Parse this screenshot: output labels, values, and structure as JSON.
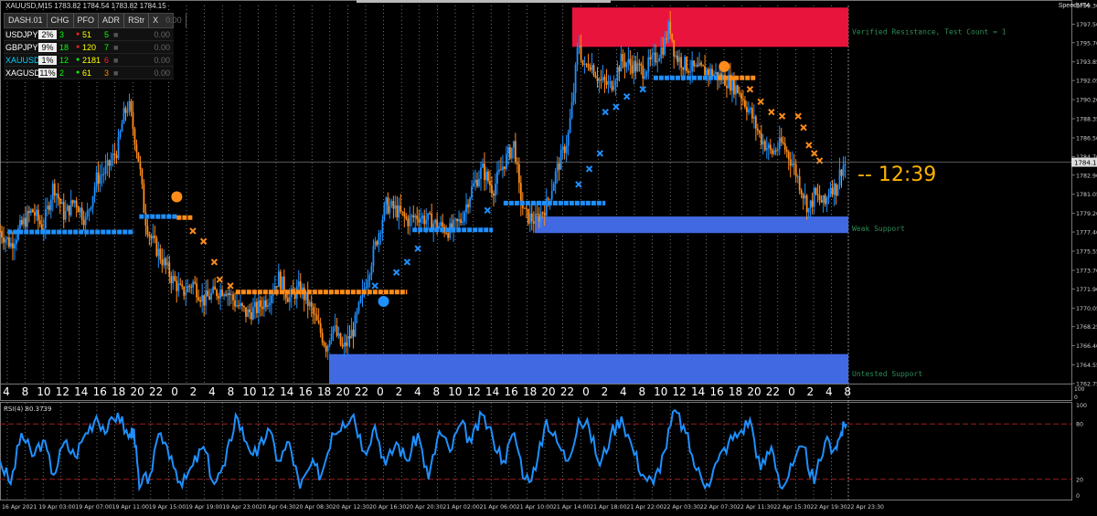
{
  "header": {
    "symbol_info": "XAUUSD,M15  1783.82 1784.54 1783.82 1784.15",
    "speed_label": "SpeedMT4"
  },
  "dashboard": {
    "title": "DASH.01",
    "columns": [
      "CHG",
      "PFO",
      "ADR",
      "RStr",
      "X"
    ],
    "rows": [
      {
        "symbol": "USDJPY",
        "chg": "2%",
        "pfo": "3",
        "adr": "51",
        "rstr": "5",
        "value": "0.00",
        "sym_color": "#ffffff",
        "pfo_color": "#00ff00",
        "dot_color": "#ff2222",
        "adr_color": "#ffff00",
        "rstr_color": "#00ff00"
      },
      {
        "symbol": "GBPJPY",
        "chg": "9%",
        "pfo": "18",
        "adr": "120",
        "rstr": "7",
        "value": "0.00",
        "sym_color": "#ffffff",
        "pfo_color": "#00ff00",
        "dot_color": "#ff2222",
        "adr_color": "#ffff00",
        "rstr_color": "#00ff00"
      },
      {
        "symbol": "XAUUSD",
        "chg": "1%",
        "pfo": "12",
        "adr": "2181",
        "rstr": "6",
        "value": "0.00",
        "sym_color": "#00d0ff",
        "pfo_color": "#00ff00",
        "dot_color": "#00ff00",
        "adr_color": "#ffff00",
        "rstr_color": "#ff2222"
      },
      {
        "symbol": "XAGUSD",
        "chg": "11%",
        "pfo": "2",
        "adr": "61",
        "rstr": "3",
        "value": "0.00",
        "sym_color": "#ffffff",
        "pfo_color": "#00ff00",
        "dot_color": "#00ff00",
        "adr_color": "#ffff00",
        "rstr_color": "#ff8800"
      }
    ]
  },
  "zones": {
    "resistance_label": "Verified Resistance, Test Count = 1",
    "weak_support_label": "Weak Support",
    "untested_support_label": "Untested Support",
    "timer": "-- 12:39",
    "resistance_color": "#e8143c",
    "support_color": "#4169e1"
  },
  "price_axis": {
    "ticks": [
      "1799.30",
      "1797.50",
      "1795.70",
      "1793.85",
      "1792.05",
      "1790.20",
      "1788.35",
      "1786.50",
      "1784.70",
      "1782.90",
      "1781.05",
      "1779.20",
      "1777.40",
      "1775.55",
      "1773.70",
      "1771.90",
      "1770.05",
      "1768.25",
      "1766.40",
      "1764.55",
      "1762.75"
    ],
    "current_price": "1784.15"
  },
  "session_axis": {
    "hour_labels": [
      "4",
      "8",
      "10",
      "12",
      "14",
      "16",
      "18",
      "20",
      "22",
      "0",
      "2",
      "4",
      "8",
      "10",
      "12",
      "14",
      "16",
      "18",
      "20",
      "22",
      "0",
      "2",
      "4",
      "8",
      "10",
      "12",
      "14",
      "16",
      "18",
      "20",
      "22",
      "0",
      "2",
      "4",
      "8",
      "10",
      "12",
      "14",
      "16",
      "18",
      "20",
      "22",
      "0",
      "2",
      "4",
      "8"
    ],
    "side_ticks": [
      "100",
      "0"
    ]
  },
  "rsi": {
    "label": "RSI(4) 80.3739",
    "levels": [
      "80",
      "20"
    ],
    "axis_ticks": [
      "100",
      "0"
    ],
    "line_color": "#1e90ff"
  },
  "time_axis": {
    "labels": [
      "16 Apr 2021",
      "19 Apr 03:00",
      "19 Apr 07:00",
      "19 Apr 11:00",
      "19 Apr 15:00",
      "19 Apr 19:00",
      "19 Apr 23:00",
      "20 Apr 04:30",
      "20 Apr 08:30",
      "20 Apr 12:30",
      "20 Apr 16:30",
      "20 Apr 20:30",
      "21 Apr 02:00",
      "21 Apr 06:00",
      "21 Apr 10:00",
      "21 Apr 14:00",
      "21 Apr 18:00",
      "21 Apr 22:00",
      "22 Apr 03:30",
      "22 Apr 07:30",
      "22 Apr 11:30",
      "22 Apr 15:30",
      "22 Apr 19:30",
      "22 Apr 23:30"
    ]
  },
  "chart_data": {
    "type": "candlestick",
    "symbol": "XAUUSD",
    "timeframe": "M15",
    "ylim": [
      1762.75,
      1799.3
    ],
    "rsi_ylim": [
      0,
      100
    ],
    "current_price": 1784.15,
    "zones": [
      {
        "name": "Verified Resistance, Test Count = 1",
        "y_low": 1795.3,
        "y_high": 1799.1,
        "x_start": 0.52
      },
      {
        "name": "Weak Support",
        "y_low": 1777.3,
        "y_high": 1778.9,
        "x_start": 0.485
      },
      {
        "name": "Untested Support",
        "y_low": 1762.75,
        "y_high": 1765.6,
        "x_start": 0.3
      }
    ],
    "close_path": [
      [
        0.0,
        1777.5
      ],
      [
        0.01,
        1776.2
      ],
      [
        0.02,
        1778.0
      ],
      [
        0.03,
        1779.5
      ],
      [
        0.04,
        1777.8
      ],
      [
        0.05,
        1782.0
      ],
      [
        0.06,
        1779.0
      ],
      [
        0.07,
        1780.5
      ],
      [
        0.08,
        1778.5
      ],
      [
        0.09,
        1782.5
      ],
      [
        0.1,
        1783.5
      ],
      [
        0.11,
        1785.5
      ],
      [
        0.115,
        1788.5
      ],
      [
        0.12,
        1789.8
      ],
      [
        0.125,
        1787.0
      ],
      [
        0.13,
        1784.0
      ],
      [
        0.135,
        1779.0
      ],
      [
        0.14,
        1777.0
      ],
      [
        0.15,
        1775.0
      ],
      [
        0.16,
        1773.0
      ],
      [
        0.17,
        1771.5
      ],
      [
        0.18,
        1772.5
      ],
      [
        0.19,
        1770.8
      ],
      [
        0.2,
        1771.5
      ],
      [
        0.21,
        1772.0
      ],
      [
        0.22,
        1770.5
      ],
      [
        0.23,
        1769.5
      ],
      [
        0.24,
        1770.0
      ],
      [
        0.25,
        1771.0
      ],
      [
        0.26,
        1773.0
      ],
      [
        0.27,
        1771.0
      ],
      [
        0.28,
        1772.0
      ],
      [
        0.29,
        1770.0
      ],
      [
        0.3,
        1767.5
      ],
      [
        0.305,
        1766.2
      ],
      [
        0.31,
        1768.5
      ],
      [
        0.32,
        1766.0
      ],
      [
        0.33,
        1768.0
      ],
      [
        0.34,
        1772.0
      ],
      [
        0.35,
        1776.0
      ],
      [
        0.36,
        1780.0
      ],
      [
        0.37,
        1779.5
      ],
      [
        0.38,
        1778.5
      ],
      [
        0.39,
        1779.0
      ],
      [
        0.4,
        1778.5
      ],
      [
        0.41,
        1778.0
      ],
      [
        0.42,
        1777.5
      ],
      [
        0.43,
        1778.5
      ],
      [
        0.44,
        1781.5
      ],
      [
        0.45,
        1783.5
      ],
      [
        0.46,
        1781.5
      ],
      [
        0.47,
        1784.0
      ],
      [
        0.48,
        1786.0
      ],
      [
        0.485,
        1781.0
      ],
      [
        0.49,
        1779.0
      ],
      [
        0.5,
        1778.5
      ],
      [
        0.51,
        1780.0
      ],
      [
        0.52,
        1783.5
      ],
      [
        0.53,
        1786.5
      ],
      [
        0.535,
        1790.5
      ],
      [
        0.54,
        1796.0
      ],
      [
        0.545,
        1793.0
      ],
      [
        0.55,
        1794.0
      ],
      [
        0.56,
        1792.0
      ],
      [
        0.57,
        1791.5
      ],
      [
        0.58,
        1794.0
      ],
      [
        0.59,
        1793.5
      ],
      [
        0.6,
        1793.0
      ],
      [
        0.61,
        1794.0
      ],
      [
        0.62,
        1795.5
      ],
      [
        0.625,
        1797.5
      ],
      [
        0.63,
        1794.5
      ],
      [
        0.64,
        1793.5
      ],
      [
        0.65,
        1793.0
      ],
      [
        0.66,
        1793.0
      ],
      [
        0.67,
        1792.5
      ],
      [
        0.68,
        1792.0
      ],
      [
        0.69,
        1791.0
      ],
      [
        0.7,
        1789.0
      ],
      [
        0.71,
        1786.5
      ],
      [
        0.72,
        1785.0
      ],
      [
        0.73,
        1786.0
      ],
      [
        0.74,
        1784.0
      ],
      [
        0.75,
        1781.0
      ],
      [
        0.755,
        1779.5
      ],
      [
        0.76,
        1781.0
      ],
      [
        0.77,
        1780.0
      ],
      [
        0.775,
        1782.0
      ],
      [
        0.78,
        1781.5
      ],
      [
        0.785,
        1783.5
      ],
      [
        0.79,
        1784.2
      ]
    ],
    "rsi_path": [
      [
        0.0,
        40
      ],
      [
        0.01,
        15
      ],
      [
        0.02,
        70
      ],
      [
        0.03,
        45
      ],
      [
        0.04,
        62
      ],
      [
        0.05,
        25
      ],
      [
        0.06,
        60
      ],
      [
        0.07,
        45
      ],
      [
        0.08,
        70
      ],
      [
        0.09,
        88
      ],
      [
        0.1,
        72
      ],
      [
        0.11,
        92
      ],
      [
        0.12,
        65
      ],
      [
        0.125,
        75
      ],
      [
        0.13,
        10
      ],
      [
        0.14,
        25
      ],
      [
        0.15,
        70
      ],
      [
        0.16,
        45
      ],
      [
        0.17,
        12
      ],
      [
        0.18,
        35
      ],
      [
        0.19,
        55
      ],
      [
        0.2,
        15
      ],
      [
        0.21,
        35
      ],
      [
        0.22,
        90
      ],
      [
        0.23,
        60
      ],
      [
        0.24,
        45
      ],
      [
        0.25,
        75
      ],
      [
        0.26,
        40
      ],
      [
        0.27,
        60
      ],
      [
        0.28,
        10
      ],
      [
        0.29,
        35
      ],
      [
        0.3,
        25
      ],
      [
        0.31,
        70
      ],
      [
        0.32,
        82
      ],
      [
        0.33,
        90
      ],
      [
        0.34,
        50
      ],
      [
        0.35,
        78
      ],
      [
        0.36,
        35
      ],
      [
        0.37,
        60
      ],
      [
        0.38,
        40
      ],
      [
        0.39,
        70
      ],
      [
        0.4,
        20
      ],
      [
        0.41,
        72
      ],
      [
        0.42,
        50
      ],
      [
        0.43,
        80
      ],
      [
        0.44,
        60
      ],
      [
        0.45,
        90
      ],
      [
        0.46,
        65
      ],
      [
        0.47,
        40
      ],
      [
        0.48,
        70
      ],
      [
        0.49,
        20
      ],
      [
        0.5,
        30
      ],
      [
        0.51,
        85
      ],
      [
        0.52,
        60
      ],
      [
        0.53,
        40
      ],
      [
        0.54,
        85
      ],
      [
        0.55,
        75
      ],
      [
        0.56,
        35
      ],
      [
        0.57,
        68
      ],
      [
        0.58,
        88
      ],
      [
        0.59,
        55
      ],
      [
        0.6,
        25
      ],
      [
        0.61,
        15
      ],
      [
        0.62,
        50
      ],
      [
        0.63,
        95
      ],
      [
        0.64,
        70
      ],
      [
        0.65,
        30
      ],
      [
        0.66,
        15
      ],
      [
        0.67,
        40
      ],
      [
        0.68,
        60
      ],
      [
        0.69,
        70
      ],
      [
        0.7,
        85
      ],
      [
        0.71,
        30
      ],
      [
        0.72,
        55
      ],
      [
        0.73,
        10
      ],
      [
        0.74,
        35
      ],
      [
        0.75,
        55
      ],
      [
        0.76,
        15
      ],
      [
        0.77,
        60
      ],
      [
        0.78,
        55
      ],
      [
        0.785,
        70
      ],
      [
        0.79,
        80
      ]
    ],
    "indicator_segments": [
      {
        "color": "#1e90ff",
        "x0": 0.007,
        "x1": 0.125,
        "y": 1777.4
      },
      {
        "color": "#1e90ff",
        "x0": 0.13,
        "x1": 0.165,
        "y": 1778.9
      },
      {
        "color": "#ff8c1a",
        "x0": 0.165,
        "x1": 0.18,
        "y": 1778.8
      },
      {
        "color": "#ff8c1a",
        "x0": 0.22,
        "x1": 0.38,
        "y": 1771.6
      },
      {
        "color": "#1e90ff",
        "x0": 0.385,
        "x1": 0.46,
        "y": 1777.6
      },
      {
        "color": "#1e90ff",
        "x0": 0.47,
        "x1": 0.565,
        "y": 1780.2
      },
      {
        "color": "#1e90ff",
        "x0": 0.61,
        "x1": 0.67,
        "y": 1792.3
      },
      {
        "color": "#ff8c1a",
        "x0": 0.67,
        "x1": 0.705,
        "y": 1792.3
      }
    ],
    "indicator_crosses": [
      {
        "color": "#ff8c1a",
        "points": [
          [
            0.18,
            1777.5
          ],
          [
            0.19,
            1776.5
          ],
          [
            0.2,
            1774.5
          ],
          [
            0.205,
            1772.8
          ],
          [
            0.215,
            1772.2
          ],
          [
            0.7,
            1791.2
          ],
          [
            0.71,
            1790.0
          ],
          [
            0.72,
            1789.0
          ],
          [
            0.73,
            1788.6
          ],
          [
            0.745,
            1788.6
          ],
          [
            0.75,
            1787.5
          ],
          [
            0.755,
            1785.8
          ],
          [
            0.76,
            1785.0
          ],
          [
            0.765,
            1784.3
          ]
        ]
      },
      {
        "color": "#1e90ff",
        "points": [
          [
            0.35,
            1772.2
          ],
          [
            0.37,
            1773.5
          ],
          [
            0.38,
            1774.5
          ],
          [
            0.39,
            1775.8
          ],
          [
            0.455,
            1779.5
          ],
          [
            0.54,
            1782.0
          ],
          [
            0.55,
            1783.5
          ],
          [
            0.56,
            1785.0
          ],
          [
            0.565,
            1789.0
          ],
          [
            0.575,
            1789.5
          ],
          [
            0.585,
            1790.5
          ],
          [
            0.6,
            1791.2
          ]
        ]
      }
    ],
    "signal_dots": [
      {
        "color": "#ff8c1a",
        "x": 0.165,
        "y": 1780.8
      },
      {
        "color": "#1e90ff",
        "x": 0.358,
        "y": 1770.7
      },
      {
        "color": "#ff8c1a",
        "x": 0.676,
        "y": 1793.4
      }
    ]
  }
}
